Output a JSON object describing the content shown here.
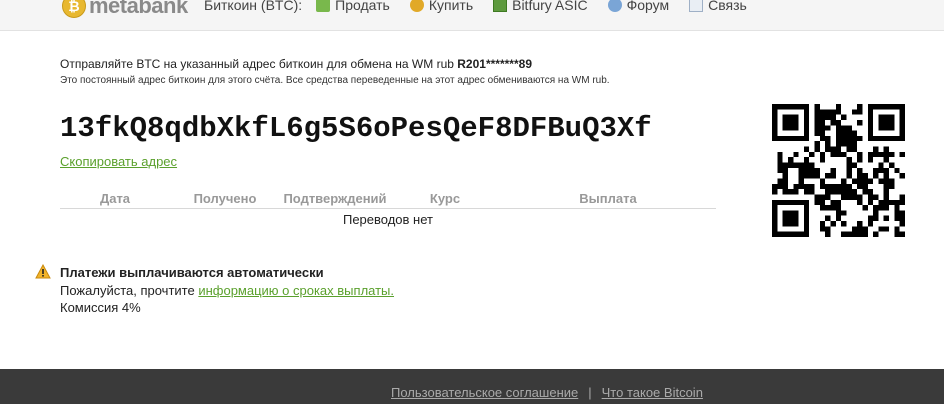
{
  "header": {
    "logo_text": "metabank",
    "logo_glyph": "₿",
    "crumb": "Биткоин (BTC):",
    "nav": [
      {
        "label": "Продать",
        "icon": "sell-icon"
      },
      {
        "label": "Купить",
        "icon": "bitcoin-coin-icon"
      },
      {
        "label": "Bitfury ASIC",
        "icon": "asic-chip-icon"
      },
      {
        "label": "Форум",
        "icon": "forum-icon"
      },
      {
        "label": "Связь",
        "icon": "mail-icon"
      }
    ]
  },
  "main": {
    "lead_text": "Отправляйте BTC на указанный адрес биткоин для обмена на WM rub ",
    "wm_purse": "R201*******89",
    "sublead": "Это постоянный адрес биткоин для этого счёта. Все средства переведенные на этот адрес обмениваются на WM rub.",
    "address": "13fkQ8qdbXkfL6g5S6oPesQeF8DFBuQ3Xf",
    "copy_label": "Скопировать адрес",
    "table": {
      "columns": [
        "Дата",
        "Получено",
        "Подтверждений",
        "Курс",
        "Выплата"
      ],
      "empty_text": "Переводов нет"
    }
  },
  "notice": {
    "icon": "warning-icon",
    "title": "Платежи выплачиваются автоматически",
    "text_prefix": "Пожалуйста, прочтите ",
    "link_text": "информацию о сроках выплаты.",
    "fee": "Комиссия 4%"
  },
  "footer": {
    "links": [
      "Пользовательское соглашение",
      "Что такое Bitcoin"
    ],
    "separator": "|"
  },
  "colors": {
    "accent_green": "#5aa02c",
    "footer_bg": "#3a3a3a"
  }
}
